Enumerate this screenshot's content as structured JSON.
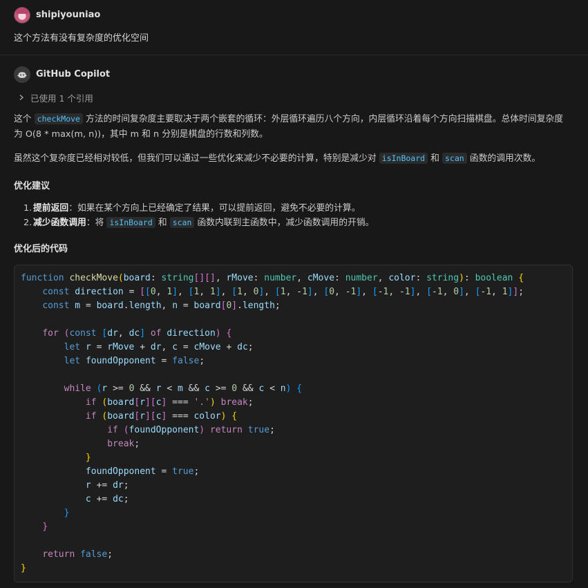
{
  "user": {
    "name": "shipiyouniao",
    "question": "这个方法有没有复杂度的优化空间"
  },
  "assistant": {
    "name": "GitHub Copilot",
    "references_label": "已使用 1 个引用",
    "p1_a": "这个 ",
    "p1_code": "checkMove",
    "p1_b": " 方法的时间复杂度主要取决于两个嵌套的循环：外层循环遍历八个方向，内层循环沿着每个方向扫描棋盘。总体时间复杂度",
    "p1_c": "为 O(8 * max(m, n))，其中 m 和 n 分别是棋盘的行数和列数。",
    "p2_a": "虽然这个复杂度已经相对较低，但我们可以通过一些优化来减少不必要的计算，特别是减少对 ",
    "p2_code1": "isInBoard",
    "p2_mid": " 和 ",
    "p2_code2": "scan",
    "p2_b": " 函数的调用次数。",
    "heading1": "优化建议",
    "list": [
      {
        "num": "1.",
        "bold": "提前返回",
        "rest": "：如果在某个方向上已经确定了结果，可以提前返回，避免不必要的计算。"
      },
      {
        "num": "2.",
        "bold": "减少函数调用",
        "rest_a": "：将 ",
        "code1": "isInBoard",
        "mid": " 和 ",
        "code2": "scan",
        "rest_b": " 函数内联到主函数中，减少函数调用的开销。"
      }
    ],
    "heading2": "优化后的代码"
  },
  "code_block": {
    "language": "typescript",
    "lines": [
      "function checkMove(board: string[][], rMove: number, cMove: number, color: string): boolean {",
      "    const direction = [[0, 1], [1, 1], [1, 0], [1, -1], [0, -1], [-1, -1], [-1, 0], [-1, 1]];",
      "    const m = board.length, n = board[0].length;",
      "",
      "    for (const [dr, dc] of direction) {",
      "        let r = rMove + dr, c = cMove + dc;",
      "        let foundOpponent = false;",
      "",
      "        while (r >= 0 && r < m && c >= 0 && c < n) {",
      "            if (board[r][c] === '.') break;",
      "            if (board[r][c] === color) {",
      "                if (foundOpponent) return true;",
      "                break;",
      "            }",
      "            foundOpponent = true;",
      "            r += dr;",
      "            c += dc;",
      "        }",
      "    }",
      "",
      "    return false;",
      "}"
    ]
  },
  "icons": {
    "user_avatar": "anime-avatar-icon",
    "bot_avatar": "copilot-icon",
    "references": "chevron-right-icon"
  }
}
